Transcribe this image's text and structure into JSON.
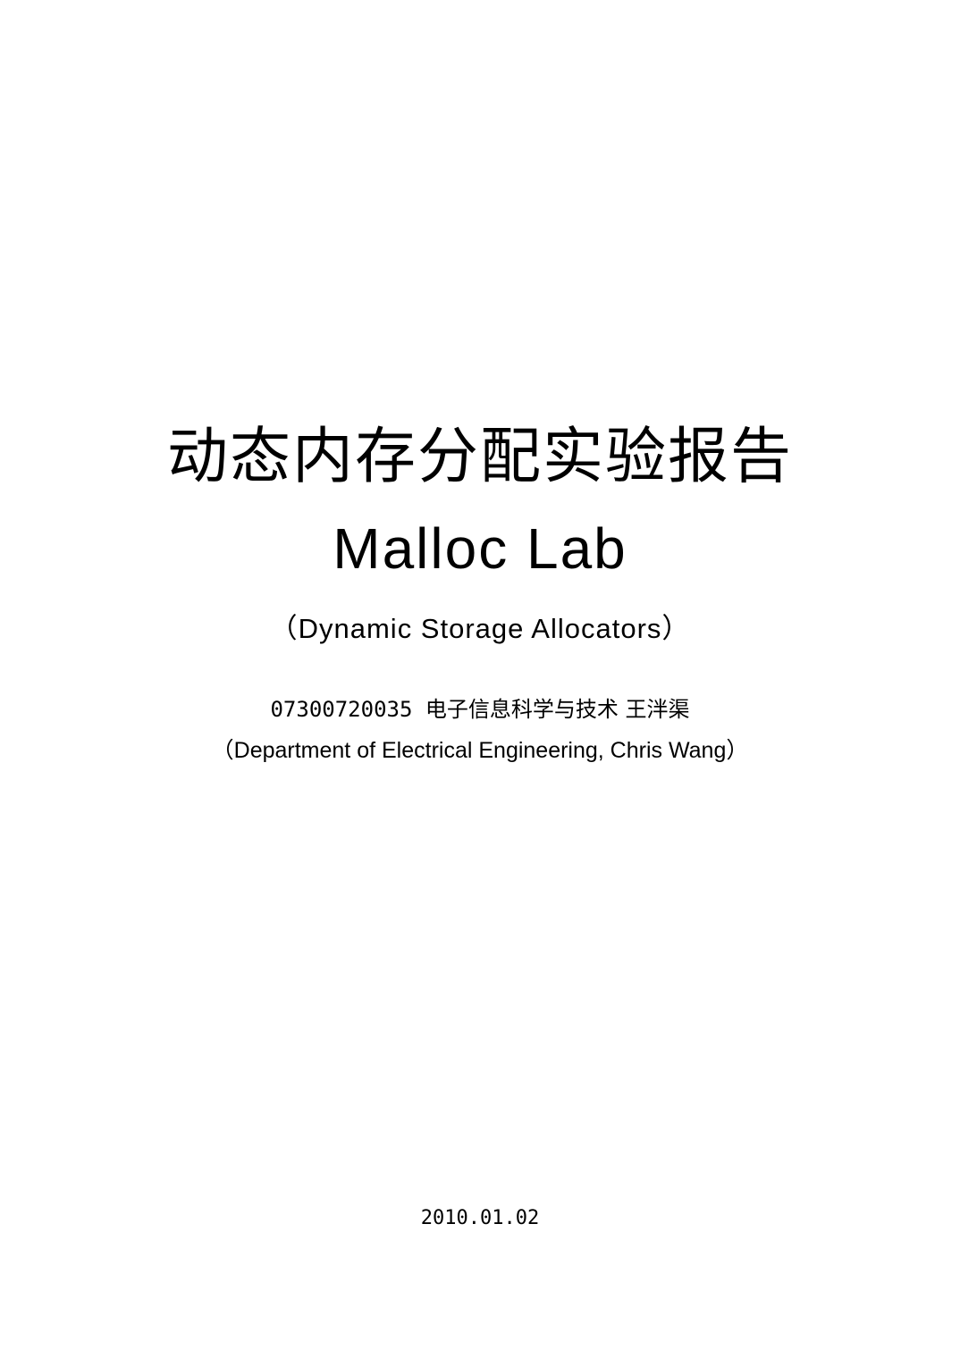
{
  "cover": {
    "title_cn": "动态内存分配实验报告",
    "title_en": "Malloc Lab",
    "subtitle": "（Dynamic Storage Allocators）",
    "student_id": "07300720035",
    "major_and_name": "电子信息科学与技术  王泮渠",
    "department": "（Department of Electrical Engineering, Chris Wang）",
    "date": "2010.01.02"
  }
}
